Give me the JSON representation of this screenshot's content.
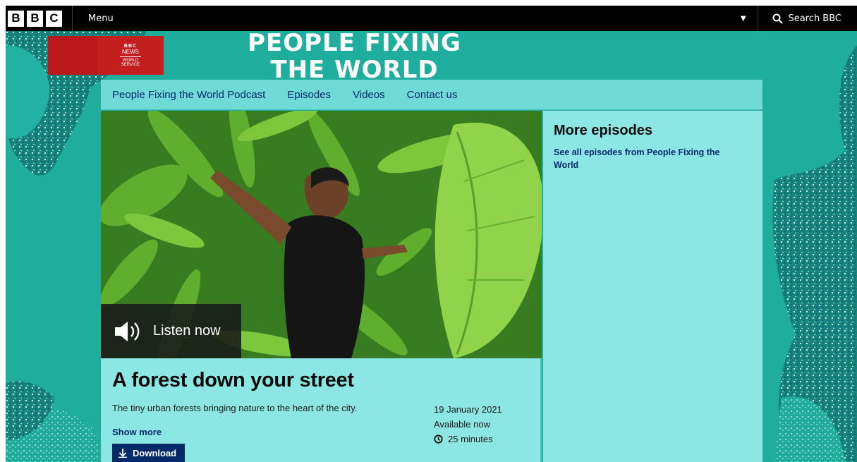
{
  "topbar": {
    "logo_letters": [
      "B",
      "B",
      "C"
    ],
    "menu_label": "Menu",
    "search_label": "Search BBC"
  },
  "brand": {
    "ws_bbc": "BBC",
    "ws_news": "NEWS",
    "ws_service_line1": "WORLD",
    "ws_service_line2": "SERVICE",
    "show_title_line1": "PEOPLE FIXING",
    "show_title_line2": "THE WORLD"
  },
  "nav": {
    "items": [
      {
        "label": "People Fixing the World Podcast"
      },
      {
        "label": "Episodes"
      },
      {
        "label": "Videos"
      },
      {
        "label": "Contact us"
      }
    ]
  },
  "episode": {
    "listen_label": "Listen now",
    "title": "A forest down your street",
    "description": "The tiny urban forests bringing nature to the heart of the city.",
    "show_more": "Show more",
    "download": "Download",
    "date": "19 January 2021",
    "availability": "Available now",
    "duration": "25 minutes"
  },
  "sidebar": {
    "heading": "More episodes",
    "link": "See all episodes from People Fixing the World"
  },
  "colors": {
    "teal": "#1fad9e",
    "panel": "#8ce6e3",
    "nav": "#6fdad6",
    "link": "#052a6a",
    "bbc_red": "#bb1919"
  }
}
